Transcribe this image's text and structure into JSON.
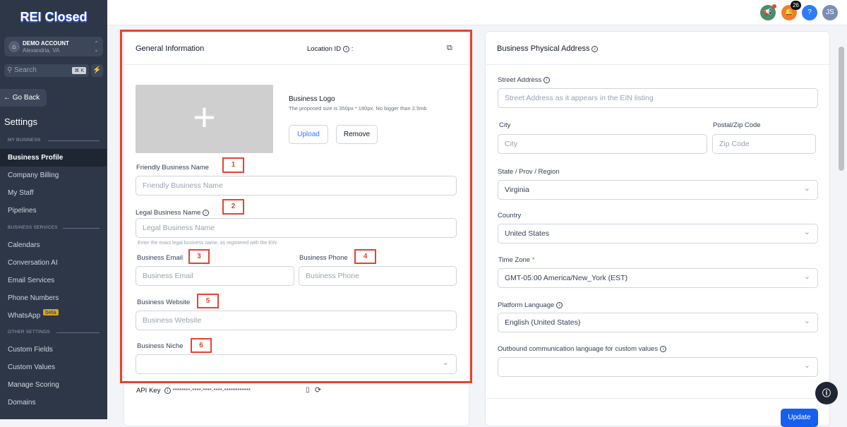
{
  "sidebar": {
    "logo": "REI Closed",
    "account_name": "DEMO ACCOUNT",
    "account_location": "Alexandria, VA",
    "search_placeholder": "Search",
    "search_shortcut": "⌘ K",
    "go_back": "← Go Back",
    "title": "Settings",
    "sections": {
      "my_business": "MY BUSINESS",
      "business_services": "BUSINESS SERVICES",
      "other_settings": "OTHER SETTINGS"
    },
    "items": [
      "Business Profile",
      "Company Billing",
      "My Staff",
      "Pipelines",
      "Calendars",
      "Conversation AI",
      "Email Services",
      "Phone Numbers",
      "WhatsApp",
      "Custom Fields",
      "Custom Values",
      "Manage Scoring",
      "Domains"
    ],
    "beta_badge": "beta"
  },
  "topbar": {
    "notification_count": "26",
    "help": "?",
    "avatar_initials": "JS"
  },
  "general": {
    "title": "General Information",
    "location_id_label": "Location ID",
    "location_id_value": ":",
    "logo_label": "Business Logo",
    "logo_hint": "The proposed size is 350px * 180px. No bigger than 2.5mb",
    "upload": "Upload",
    "remove": "Remove",
    "friendly_label": "Friendly Business Name",
    "friendly_placeholder": "Friendly Business Name",
    "legal_label": "Legal Business Name",
    "legal_placeholder": "Legal Business Name",
    "legal_help": "Enter the exact legal business name, as registered with the EIN",
    "email_label": "Business Email",
    "email_placeholder": "Business Email",
    "phone_label": "Business Phone",
    "phone_placeholder": "Business Phone",
    "website_label": "Business Website",
    "website_placeholder": "Business Website",
    "niche_label": "Business Niche",
    "api_key_label": "API Key",
    "api_key_value": "********-****-****-****-************"
  },
  "annotations": [
    "1",
    "2",
    "3",
    "4",
    "5",
    "6"
  ],
  "address": {
    "title": "Business Physical Address",
    "street_label": "Street Address",
    "street_placeholder": "Street Address as it appears in the EIN listing",
    "city_label": "City",
    "city_placeholder": "City",
    "zip_label": "Postal/Zip Code",
    "zip_placeholder": "Zip Code",
    "state_label": "State / Prov / Region",
    "state_value": "Virginia",
    "country_label": "Country",
    "country_value": "United States",
    "timezone_label": "Time Zone",
    "required_mark": "*",
    "timezone_value": "GMT-05:00 America/New_York (EST)",
    "platform_language_label": "Platform Language",
    "platform_language_value": "English (United States)",
    "outbound_label": "Outbound communication language for custom values",
    "update": "Update"
  },
  "colors": {
    "annotation": "#e5432d",
    "sidebar": "#2d3748",
    "primary": "#155eef"
  }
}
